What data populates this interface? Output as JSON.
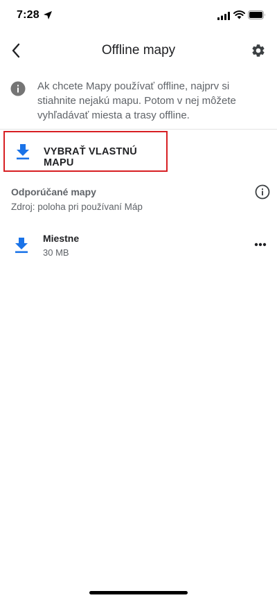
{
  "status_bar": {
    "time": "7:28"
  },
  "header": {
    "title": "Offline mapy",
    "back_icon": "chevron-left-icon",
    "settings_icon": "gear-icon"
  },
  "info_banner": {
    "icon": "info-icon",
    "text": "Ak chcete Mapy používať offline, najprv si stiahnite nejakú mapu. Potom v nej môžete vyhľadávať miesta a trasy offline."
  },
  "select_map": {
    "icon": "download-icon",
    "label": "VYBRAŤ VLASTNÚ MAPU"
  },
  "recommended": {
    "title": "Odporúčané mapy",
    "subtitle": "Zdroj: poloha pri používaní Máp",
    "items": [
      {
        "name": "Miestne",
        "size": "30 MB",
        "icon": "download-icon"
      }
    ]
  },
  "colors": {
    "accent_blue": "#1a73e8",
    "highlight_red": "#d71e22",
    "text_primary": "#202124",
    "text_secondary": "#5f6368"
  }
}
